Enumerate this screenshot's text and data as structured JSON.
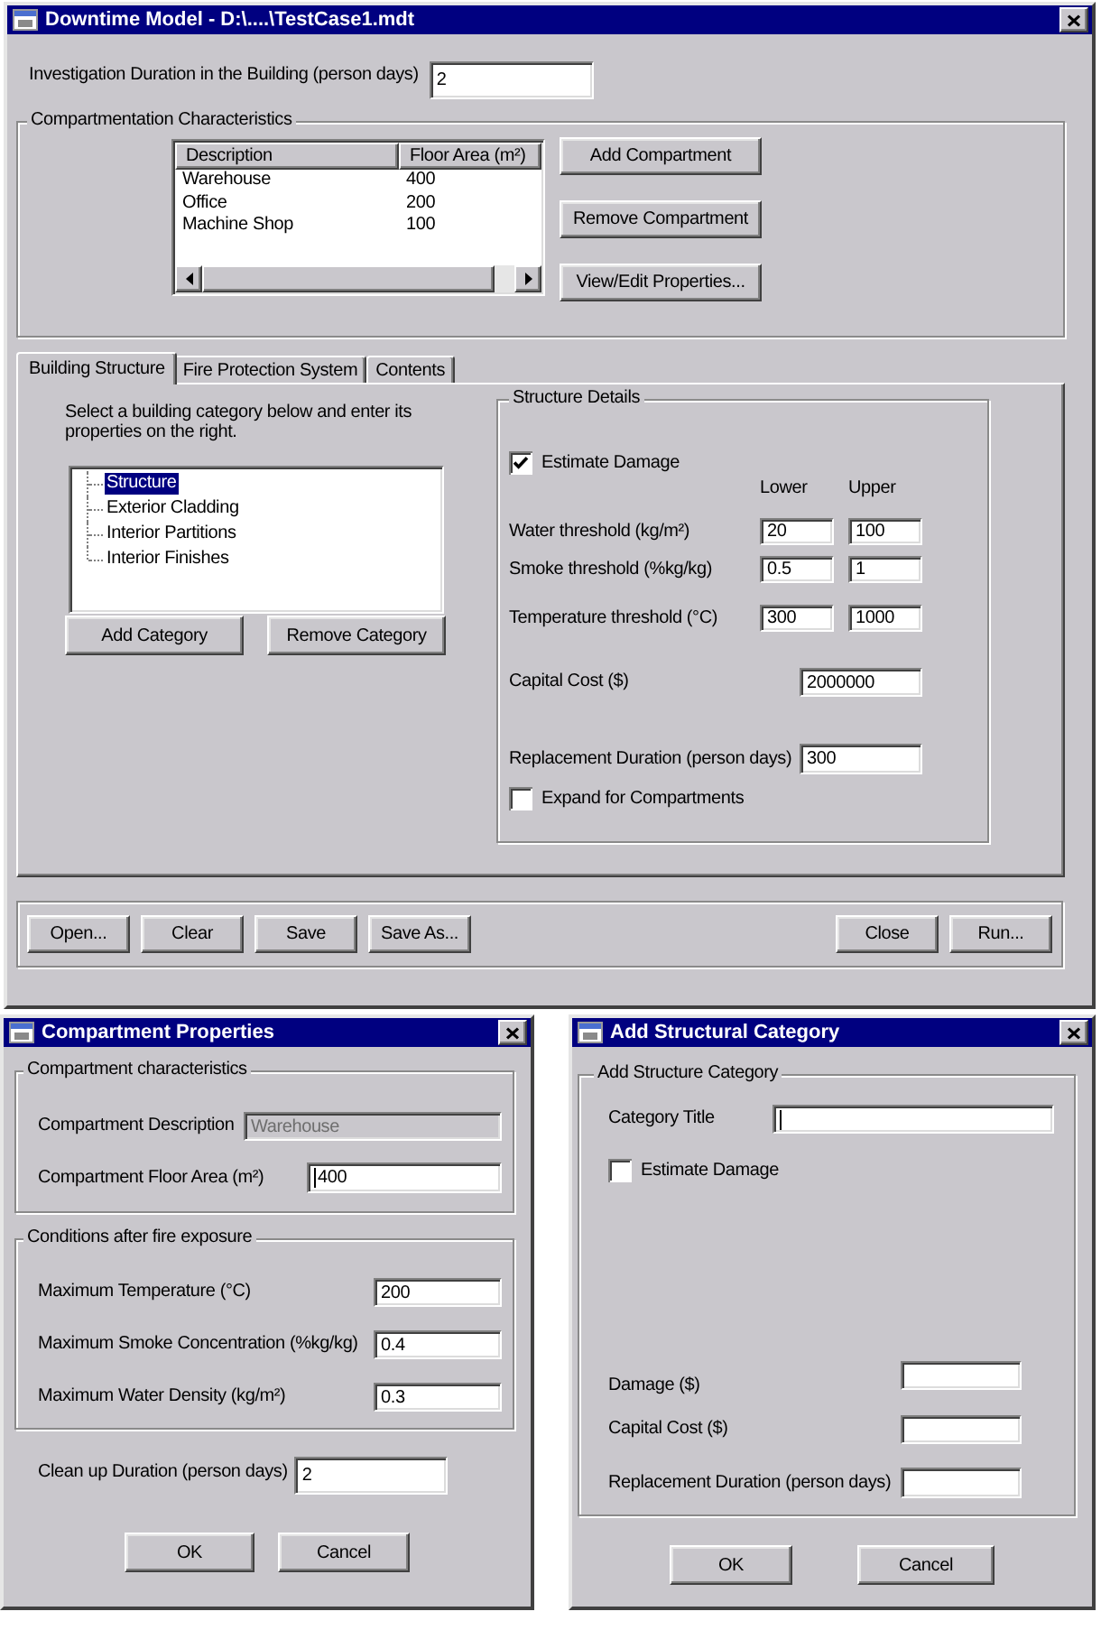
{
  "main_window": {
    "title": "Downtime Model - D:\\....\\TestCase1.mdt",
    "investigation_duration": {
      "label": "Investigation Duration in the Building (person days)",
      "value": "2"
    },
    "compartmentation": {
      "title": "Compartmentation Characteristics",
      "columns": [
        "Description",
        "Floor Area (m²)"
      ],
      "rows": [
        [
          "Warehouse",
          "400"
        ],
        [
          "Office",
          "200"
        ],
        [
          "Machine Shop",
          "100"
        ]
      ],
      "buttons": [
        "Add Compartment",
        "Remove Compartment",
        "View/Edit Properties..."
      ]
    },
    "tabs": [
      {
        "label": "Building Structure",
        "selected": true
      },
      {
        "label": "Fire Protection System",
        "selected": false
      },
      {
        "label": "Contents",
        "selected": false
      }
    ],
    "building_structure": {
      "instructions": "Select a building category below and enter its properties on the right.",
      "categories": [
        {
          "label": "Structure",
          "selected": true
        },
        {
          "label": "Exterior Cladding",
          "selected": false
        },
        {
          "label": "Interior Partitions",
          "selected": false
        },
        {
          "label": "Interior Finishes",
          "selected": false
        }
      ],
      "buttons": [
        "Add Category",
        "Remove Category"
      ]
    },
    "structure_details": {
      "title": "Structure Details",
      "estimate_damage": {
        "label": "Estimate Damage",
        "checked": true
      },
      "columns": [
        "Lower",
        "Upper"
      ],
      "thresholds": [
        {
          "label": "Water threshold (kg/m²)",
          "lower": "20",
          "upper": "100"
        },
        {
          "label": "Smoke threshold (%kg/kg)",
          "lower": "0.5",
          "upper": "1"
        },
        {
          "label": "Temperature threshold (°C)",
          "lower": "300",
          "upper": "1000"
        }
      ],
      "capital_cost": {
        "label": "Capital Cost ($)",
        "value": "2000000"
      },
      "replacement_duration": {
        "label": "Replacement Duration (person days)",
        "value": "300"
      },
      "expand_for_compartments": {
        "label": "Expand for Compartments",
        "checked": false
      }
    },
    "file_buttons": [
      "Open...",
      "Clear",
      "Save",
      "Save As..."
    ],
    "run_buttons": [
      "Close",
      "Run..."
    ]
  },
  "compartment_dialog": {
    "title": "Compartment Properties",
    "characteristics": {
      "title": "Compartment characteristics",
      "fields": [
        {
          "label": "Compartment Description",
          "value": "Warehouse",
          "disabled": true,
          "focused": false
        },
        {
          "label": "Compartment Floor Area (m²)",
          "value": "400",
          "disabled": false,
          "focused": true
        }
      ]
    },
    "conditions": {
      "title": "Conditions after fire exposure",
      "fields": [
        {
          "label": "Maximum Temperature (°C)",
          "value": "200"
        },
        {
          "label": "Maximum Smoke Concentration (%kg/kg)",
          "value": "0.4"
        },
        {
          "label": "Maximum Water Density (kg/m²)",
          "value": "0.3"
        }
      ]
    },
    "cleanup_duration": {
      "label": "Clean up Duration (person days)",
      "value": "2"
    },
    "buttons": [
      "OK",
      "Cancel"
    ]
  },
  "category_dialog": {
    "title": "Add Structural Category",
    "group_title": "Add Structure Category",
    "category_title": {
      "label": "Category Title",
      "focused": true
    },
    "estimate_damage": {
      "label": "Estimate Damage",
      "checked": false
    },
    "fields": [
      {
        "label": "Damage ($)"
      },
      {
        "label": "Capital Cost ($)"
      },
      {
        "label": "Replacement Duration (person days)"
      }
    ],
    "buttons": [
      "OK",
      "Cancel"
    ]
  }
}
